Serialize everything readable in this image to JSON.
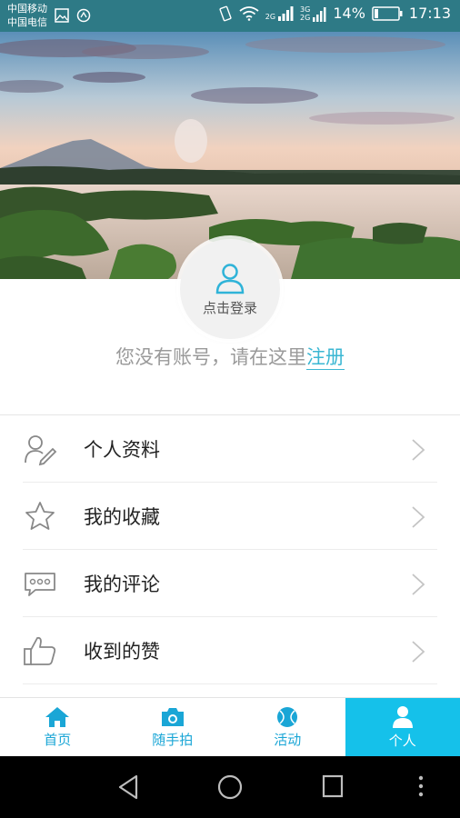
{
  "status_bar": {
    "carrier_1": "中国移动",
    "carrier_2": "中国电信",
    "net_2g": "2G",
    "net_3g": "3G",
    "net_2g_b": "2G",
    "battery": "14%",
    "time": "17:13"
  },
  "profile": {
    "login_label": "点击登录",
    "no_account_text": "您没有账号，请在这里",
    "register_link": "注册"
  },
  "menu": {
    "items": [
      {
        "label": "个人资料",
        "icon": "profile-edit-icon"
      },
      {
        "label": "我的收藏",
        "icon": "star-icon"
      },
      {
        "label": "我的评论",
        "icon": "comment-icon"
      },
      {
        "label": "收到的赞",
        "icon": "thumbs-up-icon"
      }
    ]
  },
  "tabs": {
    "items": [
      {
        "label": "首页",
        "icon": "home-icon",
        "active": false
      },
      {
        "label": "随手拍",
        "icon": "camera-icon",
        "active": false
      },
      {
        "label": "活动",
        "icon": "ball-icon",
        "active": false
      },
      {
        "label": "个人",
        "icon": "person-icon",
        "active": true
      }
    ]
  },
  "colors": {
    "accent": "#15c1ea",
    "link": "#3bb7d3",
    "status_bar": "#2e7a86"
  }
}
